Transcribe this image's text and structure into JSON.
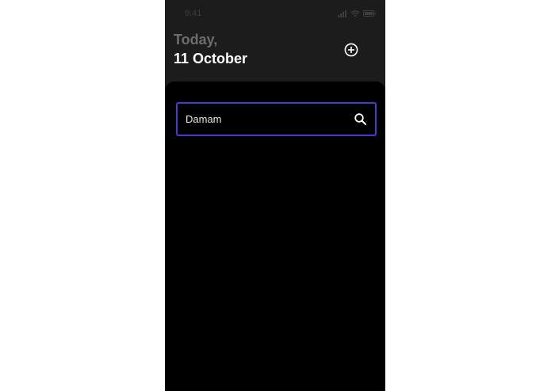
{
  "status_bar": {
    "time": "9:41"
  },
  "header": {
    "subtitle": "Today,",
    "title": "11 October"
  },
  "icons": {
    "add": "plus-circle-icon",
    "search": "magnifier-icon"
  },
  "search": {
    "value": "Damam",
    "placeholder": ""
  },
  "colors": {
    "background": "#1c1c1c",
    "sheet": "#000000",
    "accent": "#4a3bcf",
    "title": "#ffffff",
    "subtitle": "#6d6d6d"
  }
}
